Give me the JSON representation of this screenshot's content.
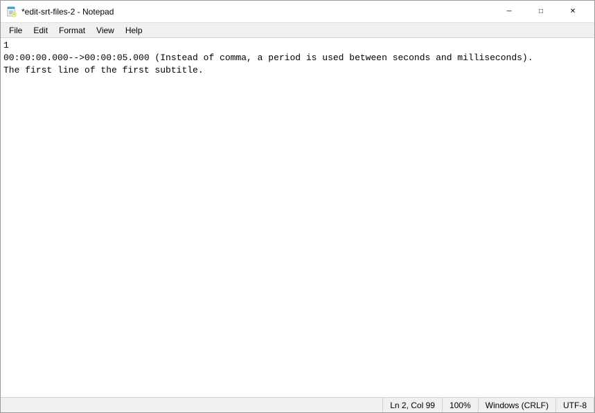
{
  "window": {
    "title": "*edit-srt-files-2 - Notepad"
  },
  "titlebar": {
    "icon": "notepad-icon",
    "minimize_label": "─",
    "maximize_label": "□",
    "close_label": "✕"
  },
  "menubar": {
    "items": [
      {
        "label": "File"
      },
      {
        "label": "Edit"
      },
      {
        "label": "Format"
      },
      {
        "label": "View"
      },
      {
        "label": "Help"
      }
    ]
  },
  "editor": {
    "content": "1\n00:00:00.000-->00:00:05.000 (Instead of comma, a period is used between seconds and milliseconds).\nThe first line of the first subtitle."
  },
  "statusbar": {
    "position": "Ln 2, Col 99",
    "zoom": "100%",
    "line_ending": "Windows (CRLF)",
    "encoding": "UTF-8"
  }
}
